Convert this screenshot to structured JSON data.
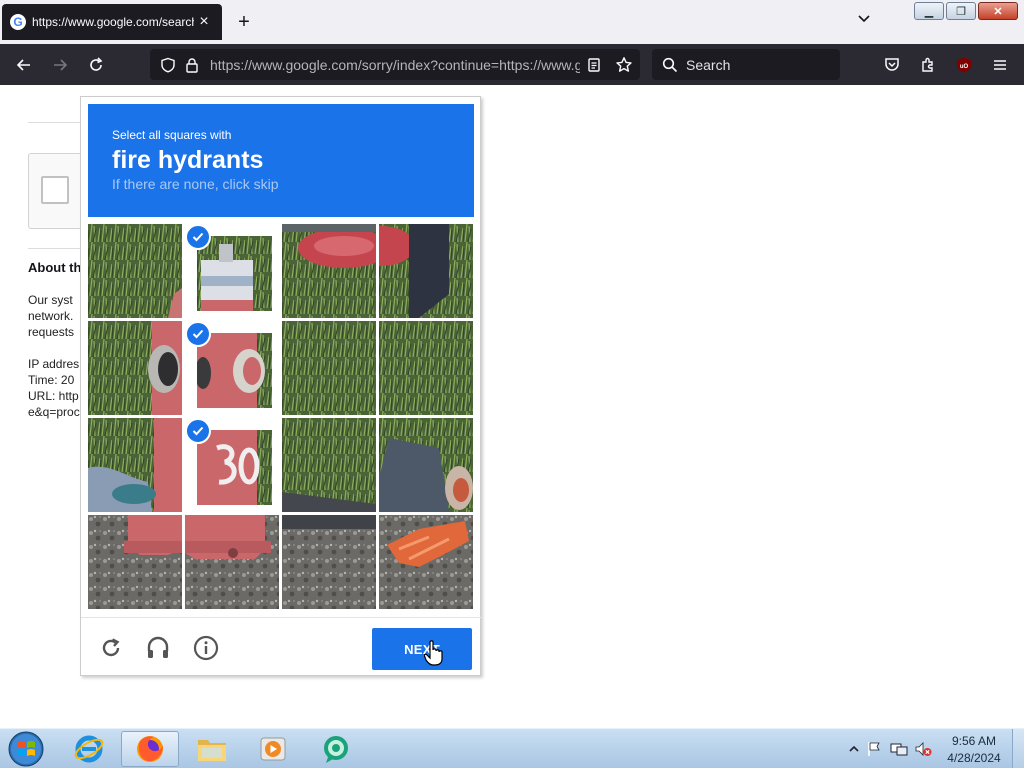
{
  "browser": {
    "tab": {
      "title": "https://www.google.com/search",
      "favicon": "G"
    },
    "url": "https://www.google.com/sorry/index?continue=https://www.g",
    "url_host": "google.com",
    "search_placeholder": "Search"
  },
  "page": {
    "about_heading": "About th",
    "para_lines": [
      "Our syst",
      "network.",
      "requests"
    ],
    "info_lines": [
      "IP addres",
      "Time: 20",
      "URL: http",
      "e&q=proc"
    ]
  },
  "captcha": {
    "instruction": "Select all squares with",
    "target": "fire hydrants",
    "subtitle": "If there are none, click skip",
    "next_label": "NEXT",
    "colors": {
      "header": "#1a73e8",
      "button": "#1a73e8"
    },
    "grid": {
      "rows": 4,
      "cols": 4,
      "selected": [
        {
          "row": 0,
          "col": 1
        },
        {
          "row": 1,
          "col": 1
        },
        {
          "row": 2,
          "col": 1
        }
      ]
    }
  },
  "taskbar": {
    "apps": [
      "internet-explorer",
      "firefox",
      "file-explorer",
      "media-player",
      "app"
    ],
    "active_app": "firefox",
    "clock": {
      "time": "9:56 AM",
      "date": "4/28/2024"
    }
  }
}
